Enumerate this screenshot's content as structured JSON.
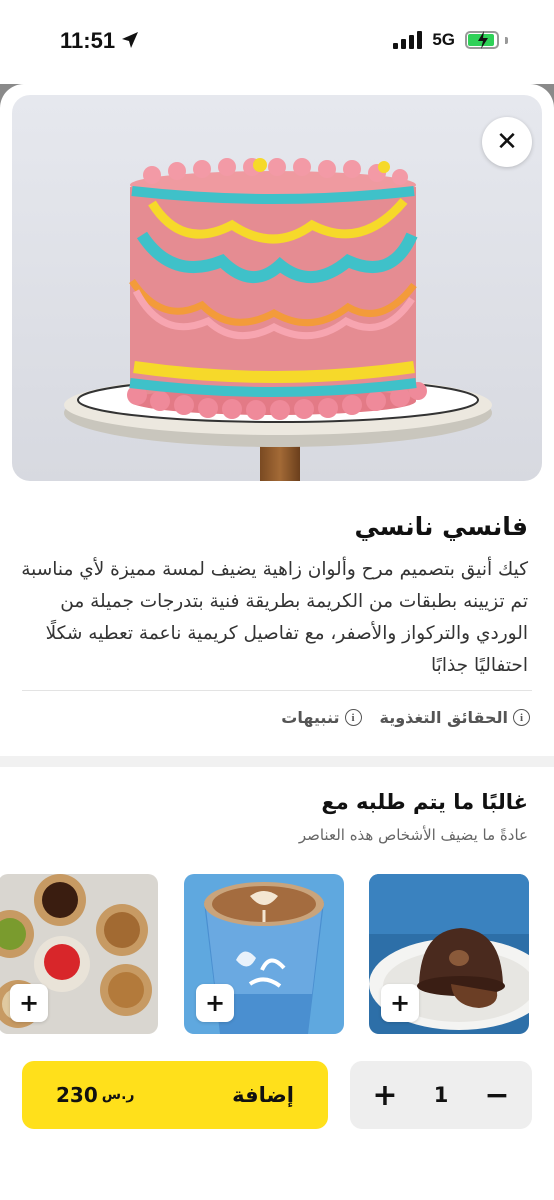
{
  "status_bar": {
    "time": "11:51",
    "network": "5G"
  },
  "product": {
    "title": "فانسي نانسي",
    "description": "كيك أنيق بتصميم مرح وألوان زاهية يضيف لمسة مميزة لأي مناسبة تم تزيينه بطبقات من الكريمة بطريقة فنية بتدرجات جميلة من الوردي والتركواز والأصفر، مع تفاصيل كريمية ناعمة تعطيه شكلًا احتفاليًا جذابًا",
    "alerts_label": "تنبيهات",
    "nutrition_label": "الحقائق التغذوية"
  },
  "close_icon": "✕",
  "recommendations": {
    "title": "غالبًا ما يتم طلبه مع",
    "subtitle": "عادةً ما يضيف الأشخاص هذه العناصر",
    "add_icon": "+"
  },
  "cart": {
    "add_label": "إضافة",
    "price": "230",
    "currency": "ر.س",
    "quantity": "1",
    "plus": "+",
    "minus": "−"
  },
  "colors": {
    "accent": "#ffe01b",
    "battery": "#2fd158"
  }
}
